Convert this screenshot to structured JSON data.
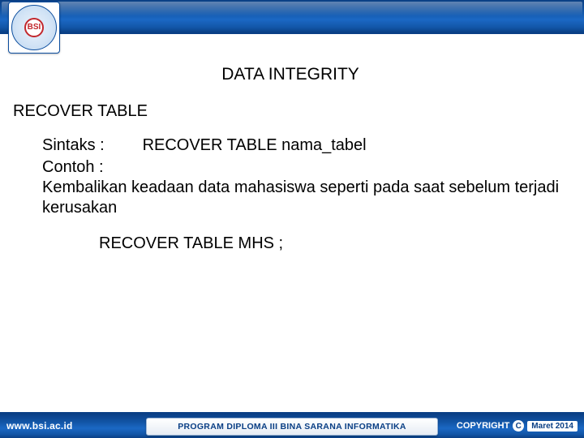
{
  "header": {
    "logo_abbrev": "BSI"
  },
  "content": {
    "title": "DATA INTEGRITY",
    "heading": "RECOVER TABLE",
    "syntax_label": "Sintaks :",
    "syntax_value": "RECOVER TABLE nama_tabel",
    "example_label": "Contoh :",
    "example_desc": "Kembalikan keadaan data mahasiswa seperti pada saat sebelum terjadi kerusakan",
    "example_cmd": "RECOVER TABLE MHS ;"
  },
  "footer": {
    "left": "www.bsi.ac.id",
    "center": "PROGRAM DIPLOMA III BINA SARANA INFORMATIKA",
    "copyright_word": "COPYRIGHT",
    "copyright_symbol": "C",
    "date": "Maret 2014"
  }
}
